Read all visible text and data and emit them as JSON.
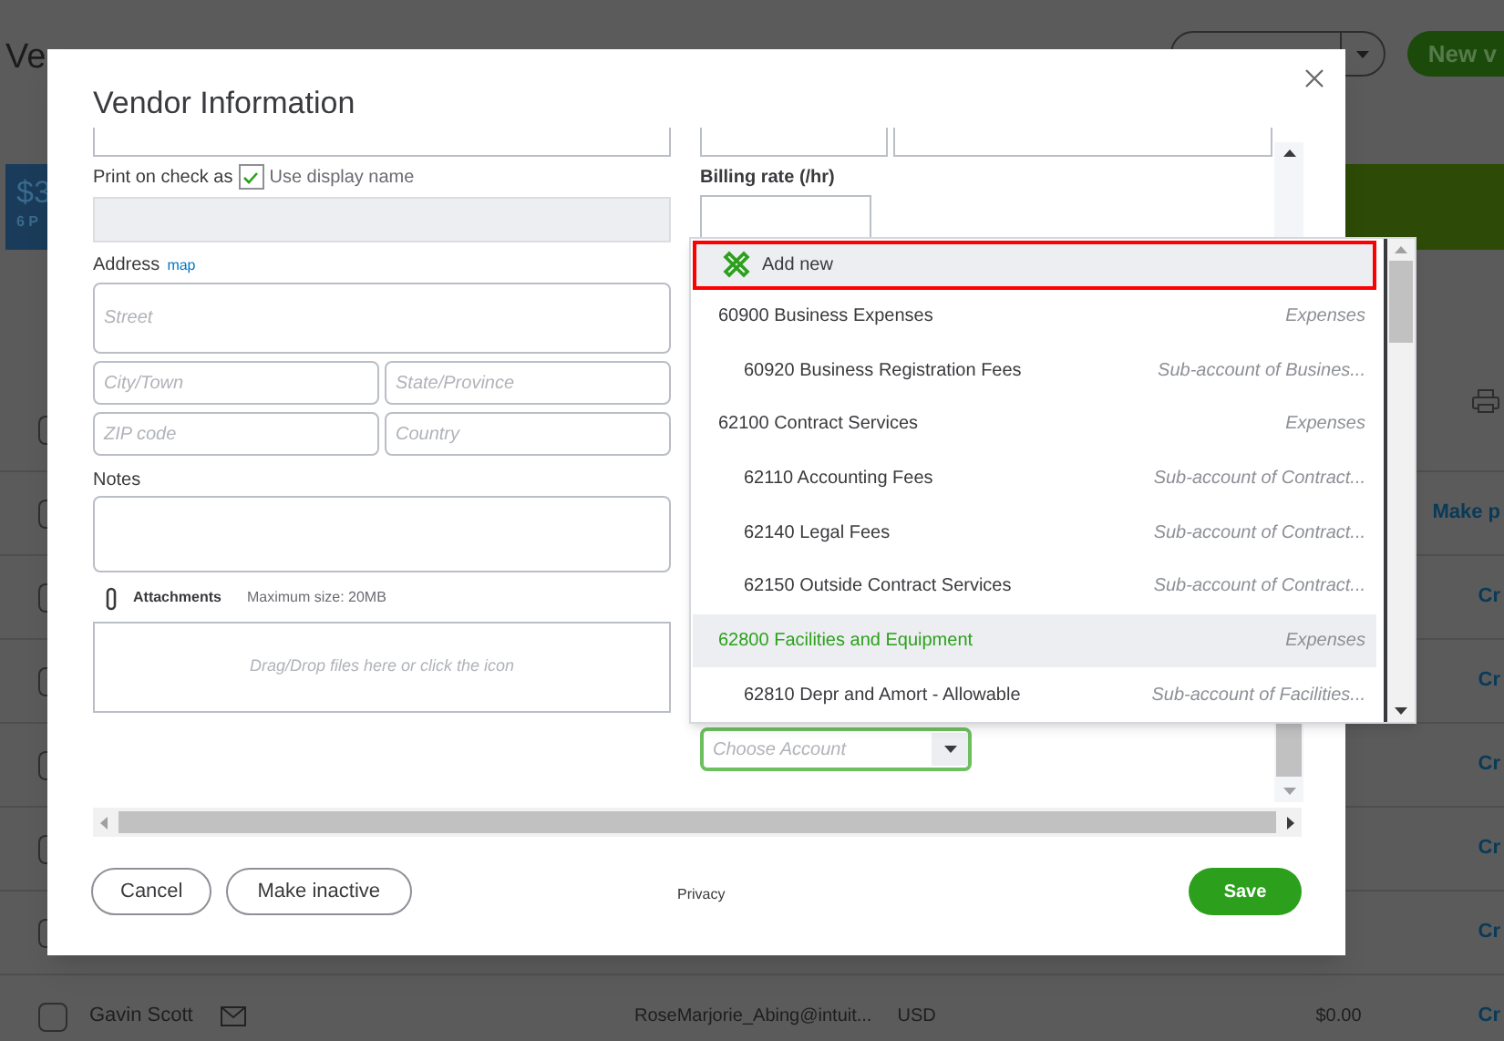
{
  "page": {
    "title": "Ve",
    "new_button": "New v",
    "summary_amount": "$3",
    "summary_count": "6 P",
    "rows": [
      {
        "kind": "print",
        "checked": false
      },
      {
        "kind": "link",
        "checked": false,
        "action": "Make p"
      },
      {
        "kind": "link",
        "checked": false,
        "action": "Cr"
      },
      {
        "kind": "link",
        "checked": false,
        "action": "Cr"
      },
      {
        "kind": "link",
        "checked": false,
        "action": "Cr"
      },
      {
        "kind": "link",
        "checked": false,
        "action": "Cr"
      },
      {
        "kind": "link",
        "checked": false,
        "action": "Cr"
      },
      {
        "kind": "vendor",
        "checked": false,
        "name": "Gavin Scott",
        "email": "RoseMarjorie_Abing@intuit...",
        "currency": "USD",
        "balance": "$0.00",
        "action": "Cr"
      }
    ]
  },
  "dialog": {
    "title": "Vendor Information",
    "print_on_check": {
      "label": "Print on check as",
      "checked": true,
      "option": "Use display name"
    },
    "address": {
      "label": "Address",
      "link": "map",
      "street": "Street",
      "city": "City/Town",
      "state": "State/Province",
      "zip": "ZIP code",
      "country": "Country"
    },
    "notes": {
      "label": "Notes"
    },
    "attachments": {
      "label": "Attachments",
      "limit": "Maximum size: 20MB",
      "drop_hint": "Drag/Drop files here or click the icon"
    },
    "billing_rate": {
      "label": "Billing rate (/hr)"
    },
    "account_select": {
      "placeholder": "Choose Account"
    },
    "account_menu": {
      "add_new": "Add new",
      "accounts": [
        {
          "label": "60900 Business Expenses",
          "type": "Expenses",
          "selected": false,
          "children": [
            {
              "label": "60920 Business Registration Fees",
              "type": "Sub-account of Busines...",
              "selected": false
            }
          ]
        },
        {
          "label": "62100 Contract Services",
          "type": "Expenses",
          "selected": false,
          "children": [
            {
              "label": "62110 Accounting Fees",
              "type": "Sub-account of Contract...",
              "selected": false
            },
            {
              "label": "62140 Legal Fees",
              "type": "Sub-account of Contract...",
              "selected": false
            },
            {
              "label": "62150 Outside Contract Services",
              "type": "Sub-account of Contract...",
              "selected": false
            }
          ]
        },
        {
          "label": "62800 Facilities and Equipment",
          "type": "Expenses",
          "selected": true,
          "children": [
            {
              "label": "62810 Depr and Amort - Allowable",
              "type": "Sub-account of Facilities...",
              "selected": false
            }
          ]
        }
      ]
    },
    "footer": {
      "cancel": "Cancel",
      "make_inactive": "Make inactive",
      "privacy": "Privacy",
      "save": "Save"
    }
  }
}
